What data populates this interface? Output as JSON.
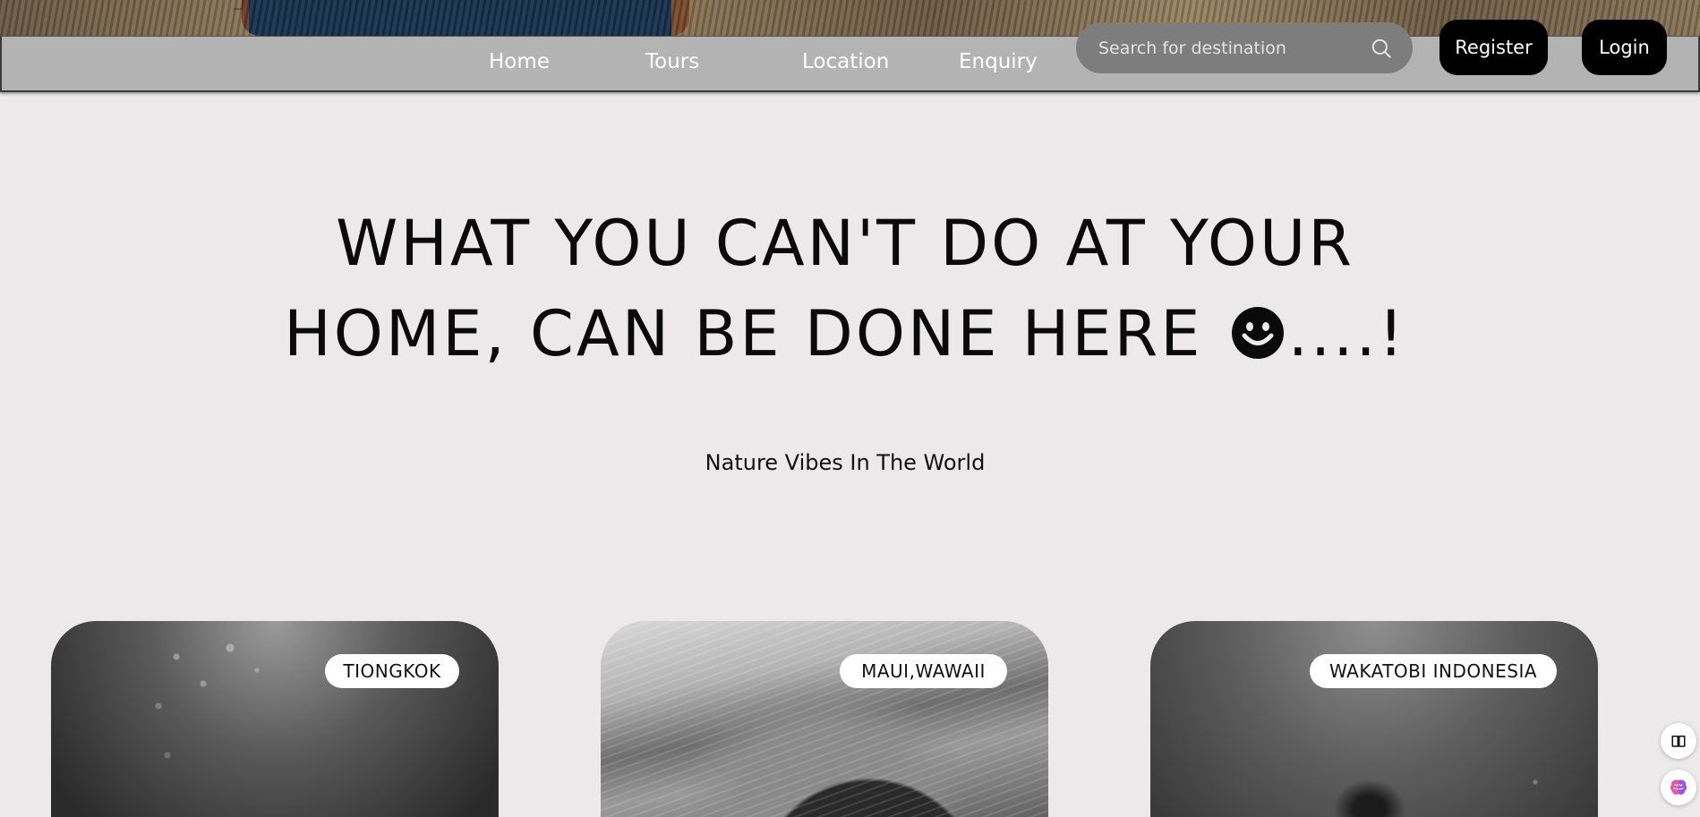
{
  "nav": {
    "links": [
      {
        "label": "Home"
      },
      {
        "label": "Tours"
      },
      {
        "label": "Location"
      },
      {
        "label": "Enquiry"
      }
    ],
    "search": {
      "placeholder": "Search for destination",
      "value": ""
    },
    "register_label": "Register",
    "login_label": "Login"
  },
  "hero": {
    "headline_line1": "WHAT YOU CAN'T DO AT YOUR",
    "headline_line2_pre": "HOME, CAN BE DONE HERE",
    "headline_line2_post": "....!",
    "subtitle": "Nature Vibes In The World"
  },
  "destinations": [
    {
      "tag": "TIONGKOK"
    },
    {
      "tag": "MAUI,WAWAII"
    },
    {
      "tag": "WAKATOBI INDONESIA"
    }
  ],
  "side_tools": [
    {
      "icon": "book-icon"
    },
    {
      "icon": "brain-icon"
    }
  ],
  "colors": {
    "background": "#ebe9ea",
    "navbar": "#b3b3b3",
    "search_bg": "#7d7d7d",
    "button_bg": "#000000",
    "button_text": "#ffffff"
  }
}
